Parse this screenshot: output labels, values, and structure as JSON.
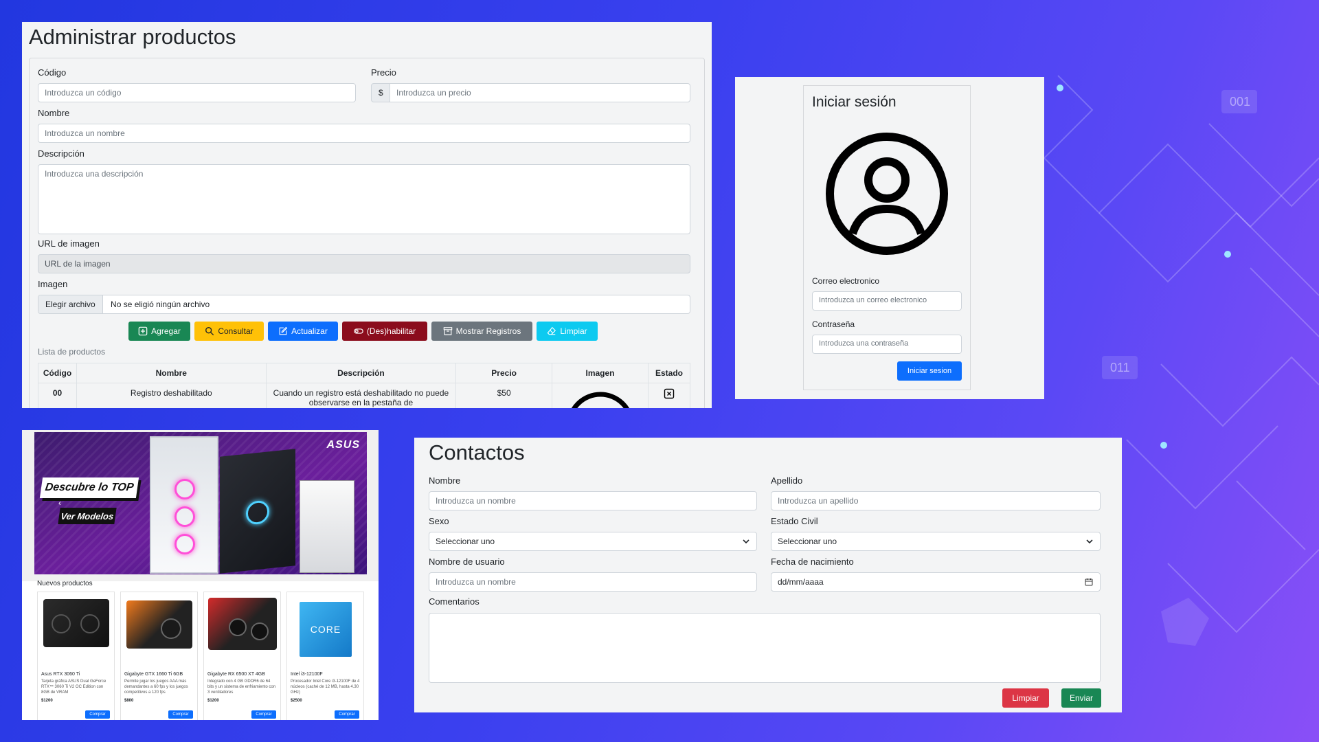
{
  "admin": {
    "title": "Administrar productos",
    "codigo_label": "Código",
    "codigo_placeholder": "Introduzca un código",
    "precio_label": "Precio",
    "precio_prefix": "$",
    "precio_placeholder": "Introduzca un precio",
    "nombre_label": "Nombre",
    "nombre_placeholder": "Introduzca un nombre",
    "descripcion_label": "Descripción",
    "descripcion_placeholder": "Introduzca una descripción",
    "url_label": "URL de imagen",
    "url_placeholder": "URL de la imagen",
    "imagen_label": "Imagen",
    "file_button": "Elegir archivo",
    "file_status": "No se eligió ningún archivo",
    "buttons": {
      "agregar": "Agregar",
      "consultar": "Consultar",
      "actualizar": "Actualizar",
      "deshabilitar": "(Des)habilitar",
      "mostrar": "Mostrar Registros",
      "limpiar": "Limpiar"
    },
    "list_caption": "Lista de productos",
    "table_headers": [
      "Código",
      "Nombre",
      "Descripción",
      "Precio",
      "Imagen",
      "Estado"
    ],
    "row": {
      "codigo": "00",
      "nombre": "Registro deshabilitado",
      "descripcion": "Cuando un registro está deshabilitado no puede observarse en la pestaña de",
      "precio": "$50"
    }
  },
  "login": {
    "title": "Iniciar sesión",
    "email_label": "Correo electronico",
    "email_placeholder": "Introduzca un correo electronico",
    "password_label": "Contraseña",
    "password_placeholder": "Introduzca una contraseña",
    "submit": "Iniciar sesion"
  },
  "shop": {
    "banner_headline": "Descubre lo TOP",
    "banner_cta": "Ver Modelos",
    "banner_brand": "ASUS",
    "section_title": "Nuevos productos",
    "products": [
      {
        "name": "Asus RTX 3060 Ti",
        "desc": "Tarjeta gráfica ASUS Dual GeForce RTX™ 3060 Ti V2 OC Edition con 8GB de VRAM",
        "price": "$1200",
        "button": "Comprar"
      },
      {
        "name": "Gigabyte GTX 1660 Ti 6GB",
        "desc": "Permite jugar los juegos AAA más demandantes a 60 fps y los juegos competitivos a 120 fps",
        "price": "$800",
        "button": "Comprar"
      },
      {
        "name": "Gigabyte RX 6500 XT 4GB",
        "desc": "Integrado con 4 GB GDDR6 de 64 bits y un sistema de enfriamiento con 3 ventiladores",
        "price": "$1200",
        "button": "Comprar"
      },
      {
        "name": "Intel i3-12100F",
        "desc": "Procesador Intel Core i3-12100F de 4 núcleos (caché de 12 MB, hasta 4.30 GHz)",
        "price": "$2500",
        "button": "Comprar"
      }
    ]
  },
  "contact": {
    "title": "Contactos",
    "nombre_label": "Nombre",
    "nombre_placeholder": "Introduzca un nombre",
    "apellido_label": "Apellido",
    "apellido_placeholder": "Introduzca un apellido",
    "sexo_label": "Sexo",
    "sexo_value": "Seleccionar uno",
    "civil_label": "Estado Civil",
    "civil_value": "Seleccionar uno",
    "usuario_label": "Nombre de usuario",
    "usuario_placeholder": "Introduzca un nombre",
    "fecha_label": "Fecha de nacimiento",
    "fecha_value": "dd/mm/aaaa",
    "comentarios_label": "Comentarios",
    "limpiar": "Limpiar",
    "enviar": "Enviar"
  },
  "background": {
    "tag_a": "001",
    "tag_b": "011"
  },
  "colors": {
    "success": "#198754",
    "warning": "#ffc107",
    "primary": "#0d6efd",
    "danger_dark": "#8b0c1c",
    "secondary": "#6c757d",
    "info": "#0dcaf0",
    "danger": "#dc3545"
  }
}
